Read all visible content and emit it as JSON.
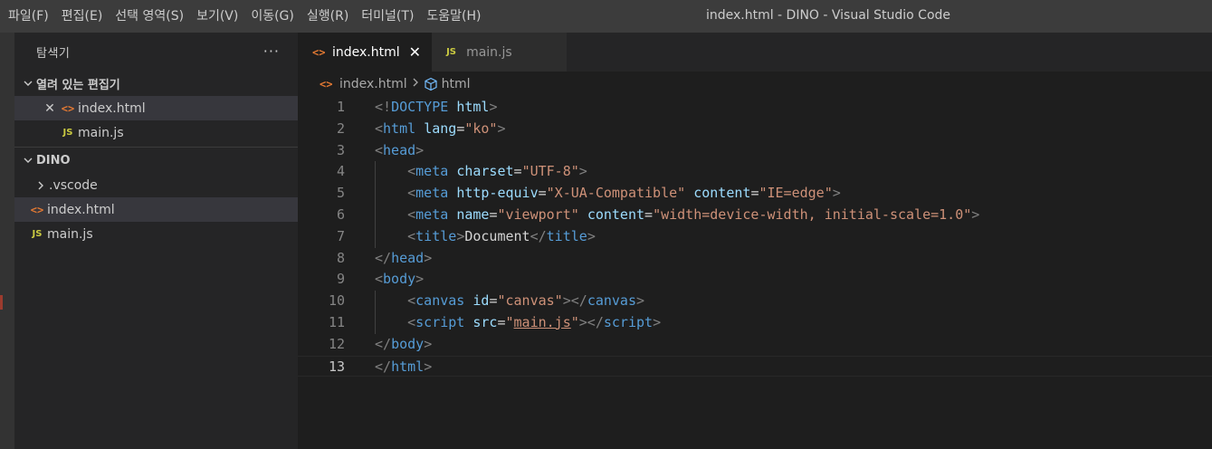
{
  "menu": [
    {
      "label": "파일(F)"
    },
    {
      "label": "편집(E)"
    },
    {
      "label": "선택 영역(S)"
    },
    {
      "label": "보기(V)"
    },
    {
      "label": "이동(G)"
    },
    {
      "label": "실행(R)"
    },
    {
      "label": "터미널(T)"
    },
    {
      "label": "도움말(H)"
    }
  ],
  "window_title": "index.html - DINO - Visual Studio Code",
  "sidebar": {
    "title": "탐색기",
    "more": "···",
    "open_editors": {
      "title": "열려 있는 편집기",
      "items": [
        {
          "label": "index.html",
          "icon": "<>"
        },
        {
          "label": "main.js",
          "icon": "JS"
        }
      ]
    },
    "folder": {
      "title": "DINO",
      "items": [
        {
          "label": ".vscode"
        },
        {
          "label": "index.html",
          "icon": "<>"
        },
        {
          "label": "main.js",
          "icon": "JS"
        }
      ]
    }
  },
  "tabs": [
    {
      "label": "index.html",
      "icon": "<>"
    },
    {
      "label": "main.js",
      "icon": "JS"
    }
  ],
  "breadcrumb": {
    "file": "index.html",
    "symbol": "html"
  },
  "colors": {
    "html_icon": "#e37933",
    "js_icon": "#cbcb41",
    "tag": "#569cd6",
    "attribute": "#9cdcfe",
    "string": "#ce9178",
    "bracket": "#808080"
  },
  "code": {
    "current_line": 13,
    "lines": [
      [
        [
          "t",
          "<!"
        ],
        [
          "e",
          "DOCTYPE"
        ],
        [
          "x",
          " "
        ],
        [
          "a",
          "html"
        ],
        [
          "t",
          ">"
        ]
      ],
      [
        [
          "t",
          "<"
        ],
        [
          "e",
          "html"
        ],
        [
          "x",
          " "
        ],
        [
          "a",
          "lang"
        ],
        [
          "x",
          "="
        ],
        [
          "s",
          "\"ko\""
        ],
        [
          "t",
          ">"
        ]
      ],
      [
        [
          "t",
          "<"
        ],
        [
          "e",
          "head"
        ],
        [
          "t",
          ">"
        ]
      ],
      [
        [
          "x",
          "    "
        ],
        [
          "t",
          "<"
        ],
        [
          "e",
          "meta"
        ],
        [
          "x",
          " "
        ],
        [
          "a",
          "charset"
        ],
        [
          "x",
          "="
        ],
        [
          "s",
          "\"UTF-8\""
        ],
        [
          "t",
          ">"
        ]
      ],
      [
        [
          "x",
          "    "
        ],
        [
          "t",
          "<"
        ],
        [
          "e",
          "meta"
        ],
        [
          "x",
          " "
        ],
        [
          "a",
          "http-equiv"
        ],
        [
          "x",
          "="
        ],
        [
          "s",
          "\"X-UA-Compatible\""
        ],
        [
          "x",
          " "
        ],
        [
          "a",
          "content"
        ],
        [
          "x",
          "="
        ],
        [
          "s",
          "\"IE=edge\""
        ],
        [
          "t",
          ">"
        ]
      ],
      [
        [
          "x",
          "    "
        ],
        [
          "t",
          "<"
        ],
        [
          "e",
          "meta"
        ],
        [
          "x",
          " "
        ],
        [
          "a",
          "name"
        ],
        [
          "x",
          "="
        ],
        [
          "s",
          "\"viewport\""
        ],
        [
          "x",
          " "
        ],
        [
          "a",
          "content"
        ],
        [
          "x",
          "="
        ],
        [
          "s",
          "\"width=device-width, initial-scale=1.0\""
        ],
        [
          "t",
          ">"
        ]
      ],
      [
        [
          "x",
          "    "
        ],
        [
          "t",
          "<"
        ],
        [
          "e",
          "title"
        ],
        [
          "t",
          ">"
        ],
        [
          "x",
          "Document"
        ],
        [
          "t",
          "</"
        ],
        [
          "e",
          "title"
        ],
        [
          "t",
          ">"
        ]
      ],
      [
        [
          "t",
          "</"
        ],
        [
          "e",
          "head"
        ],
        [
          "t",
          ">"
        ]
      ],
      [
        [
          "t",
          "<"
        ],
        [
          "e",
          "body"
        ],
        [
          "t",
          ">"
        ]
      ],
      [
        [
          "x",
          "    "
        ],
        [
          "t",
          "<"
        ],
        [
          "e",
          "canvas"
        ],
        [
          "x",
          " "
        ],
        [
          "a",
          "id"
        ],
        [
          "x",
          "="
        ],
        [
          "s",
          "\"canvas\""
        ],
        [
          "t",
          "></"
        ],
        [
          "e",
          "canvas"
        ],
        [
          "t",
          ">"
        ]
      ],
      [
        [
          "x",
          "    "
        ],
        [
          "t",
          "<"
        ],
        [
          "e",
          "script"
        ],
        [
          "x",
          " "
        ],
        [
          "a",
          "src"
        ],
        [
          "x",
          "="
        ],
        [
          "s",
          "\""
        ],
        [
          "u",
          "main.js"
        ],
        [
          "s",
          "\""
        ],
        [
          "t",
          "></"
        ],
        [
          "e",
          "script"
        ],
        [
          "t",
          ">"
        ]
      ],
      [
        [
          "t",
          "</"
        ],
        [
          "e",
          "body"
        ],
        [
          "t",
          ">"
        ]
      ],
      [
        [
          "t",
          "</"
        ],
        [
          "e",
          "html"
        ],
        [
          "t",
          ">"
        ]
      ]
    ]
  }
}
